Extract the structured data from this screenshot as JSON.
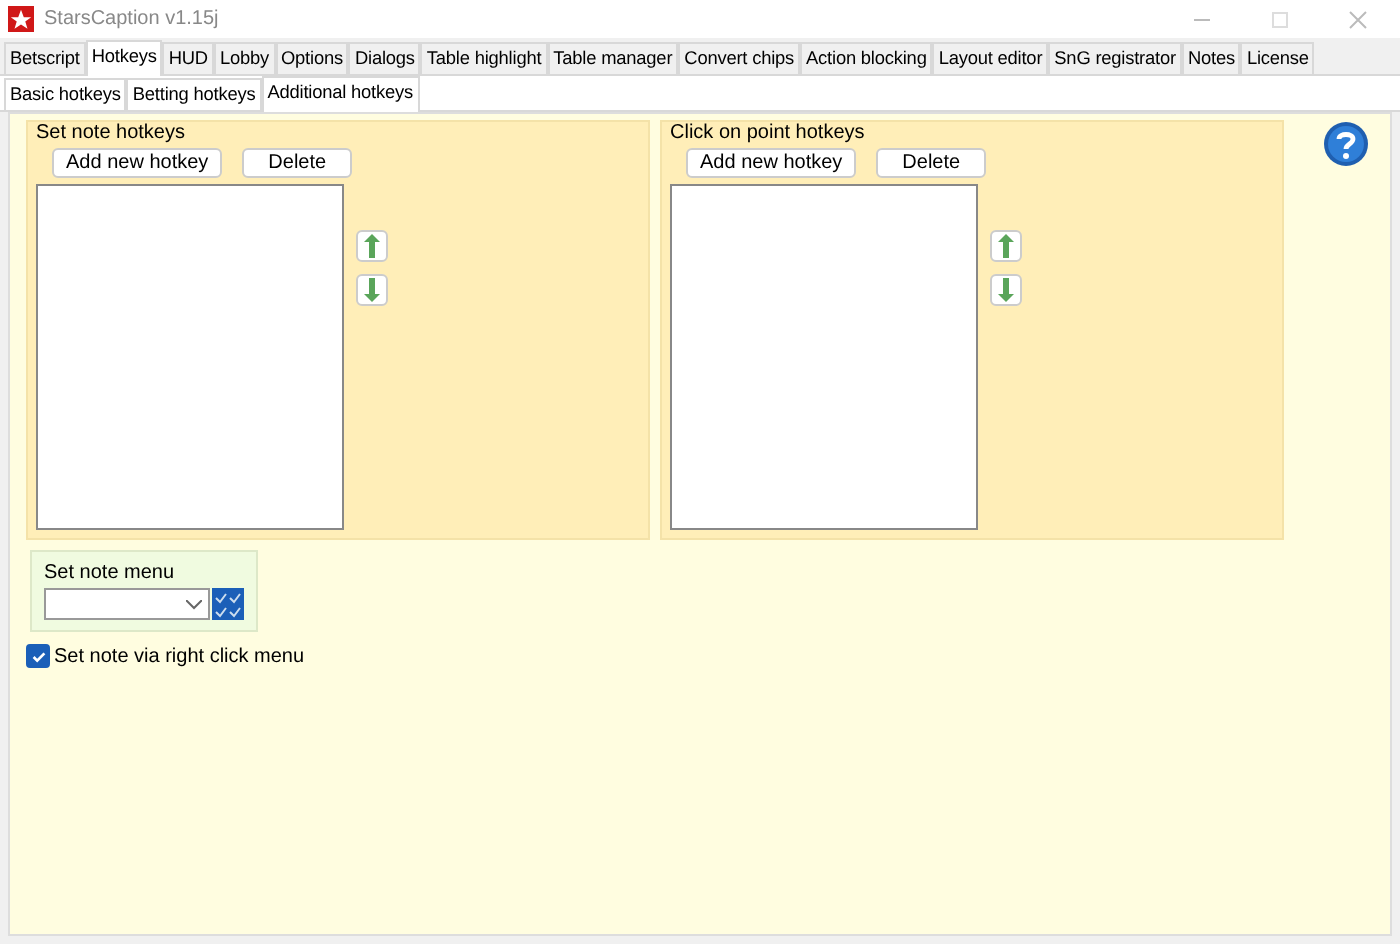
{
  "window": {
    "title": "StarsCaption v1.15j"
  },
  "tabs": [
    {
      "label": "Betscript",
      "selected": false
    },
    {
      "label": "Hotkeys",
      "selected": true
    },
    {
      "label": "HUD",
      "selected": false
    },
    {
      "label": "Lobby",
      "selected": false
    },
    {
      "label": "Options",
      "selected": false
    },
    {
      "label": "Dialogs",
      "selected": false
    },
    {
      "label": "Table highlight",
      "selected": false
    },
    {
      "label": "Table manager",
      "selected": false
    },
    {
      "label": "Convert chips",
      "selected": false
    },
    {
      "label": "Action blocking",
      "selected": false
    },
    {
      "label": "Layout editor",
      "selected": false
    },
    {
      "label": "SnG registrator",
      "selected": false
    },
    {
      "label": "Notes",
      "selected": false
    },
    {
      "label": "License",
      "selected": false
    }
  ],
  "subtabs": [
    {
      "label": "Basic hotkeys",
      "selected": false
    },
    {
      "label": "Betting hotkeys",
      "selected": false
    },
    {
      "label": "Additional hotkeys",
      "selected": true
    }
  ],
  "groups": [
    {
      "title": "Set note hotkeys",
      "buttons": [
        "Add new hotkey",
        "Delete"
      ]
    },
    {
      "title": "Click on point hotkeys",
      "buttons": [
        "Add new hotkey",
        "Delete"
      ]
    }
  ],
  "note_menu": {
    "title": "Set note menu"
  },
  "right_click": {
    "label": "Set note via right click menu",
    "checked": true
  }
}
